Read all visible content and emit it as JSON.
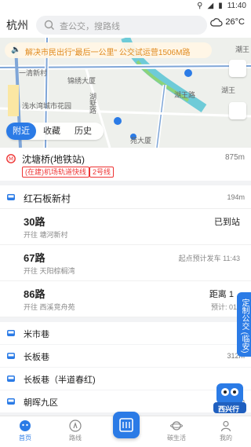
{
  "status": {
    "time": "11:40"
  },
  "header": {
    "city": "杭州",
    "search_placeholder": "查公交，搜路线",
    "temp": "26°C"
  },
  "notice": {
    "text": "解决市民出行\"最后一公里\" 公交试运营1506M路"
  },
  "map_labels": [
    "一清新村",
    "锦绣大厦",
    "浅水湾城市花园",
    "湖墅路",
    "湖王路",
    "苑大厦",
    "湖王",
    "潮王"
  ],
  "tabs": [
    "附近",
    "收藏",
    "历史"
  ],
  "metro": {
    "name": "沈塘桥(地铁站)",
    "dist": "875m",
    "tags": [
      "(在建)机场轨道快线",
      "2号线"
    ]
  },
  "stop1": {
    "name": "红石板新村",
    "dist": "194m"
  },
  "routes": [
    {
      "num": "30路",
      "dir": "开往 塘河新村",
      "status": "已到站",
      "sub": ""
    },
    {
      "num": "67路",
      "dir": "开往 天阳棕榈湾",
      "status": "起点预计发车 11:43",
      "sub": ""
    },
    {
      "num": "86路",
      "dir": "开往 西溪竞舟苑",
      "status": "距离 1",
      "sub": "预计: 01"
    }
  ],
  "stops": [
    {
      "name": "米市巷",
      "dist": "28"
    },
    {
      "name": "长板巷",
      "dist": "312m"
    },
    {
      "name": "长板巷（半道春红)",
      "dist": ""
    },
    {
      "name": "朝晖九区",
      "dist": "375m"
    }
  ],
  "side_tab": "定制公交 (临安)",
  "mascot_text": "西兴行",
  "nav": {
    "home": "首页",
    "route": "路线",
    "life": "碳生活",
    "mine": "我的"
  },
  "colors": {
    "accent": "#2b7be6",
    "metro_red": "#e33333"
  }
}
